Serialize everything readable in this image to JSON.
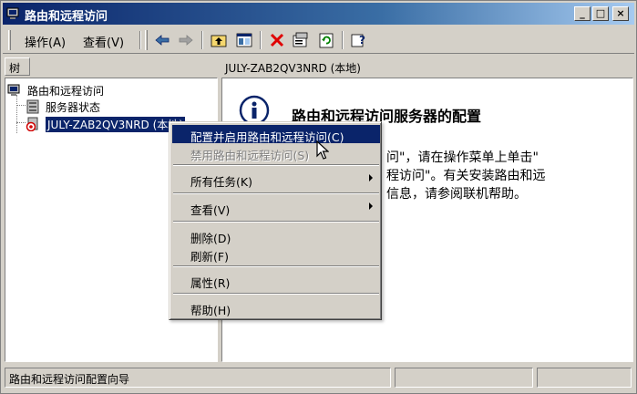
{
  "window": {
    "title": "路由和远程访问",
    "caption_minimize": "_",
    "caption_maximize": "□",
    "caption_close": "×"
  },
  "menu": {
    "action": "操作(A)",
    "view": "查看(V)"
  },
  "toolbar": {
    "buttons": [
      "back-arrow-icon",
      "forward-arrow-icon",
      "up-folder-icon",
      "show-hide-tree-icon",
      "delete-icon",
      "properties-icon",
      "refresh-icon",
      "help-icon"
    ]
  },
  "tree_pane": {
    "tab_label": "树",
    "items": [
      {
        "label": "路由和远程访问",
        "icon": "routing-icon"
      },
      {
        "label": "服务器状态",
        "icon": "server-status-icon"
      },
      {
        "label": "JULY-ZAB2QV3NRD (本地)",
        "icon": "server-down-icon"
      }
    ]
  },
  "right_pane": {
    "header": "JULY-ZAB2QV3NRD (本地)",
    "title": "路由和远程访问服务器的配置",
    "lines": [
      "问\"，请在操作菜单上单击\"",
      "程访问\"。有关安装路由和远",
      "信息，请参阅联机帮助。"
    ]
  },
  "context_menu": {
    "items": [
      {
        "label": "配置并启用路由和远程访问(C)",
        "state": "highlight"
      },
      {
        "label": "禁用路由和远程访问(S)",
        "state": "disabled"
      },
      {
        "label": "所有任务(K)",
        "submenu": true
      },
      {
        "label": "查看(V)",
        "submenu": true
      },
      {
        "label": "删除(D)"
      },
      {
        "label": "刷新(F)"
      },
      {
        "label": "属性(R)"
      },
      {
        "label": "帮助(H)"
      }
    ]
  },
  "statusbar": {
    "text": "路由和远程访问配置向导"
  },
  "colors": {
    "title_active": "#0a246a",
    "face": "#d4d0c8",
    "highlight": "#0a246a"
  }
}
